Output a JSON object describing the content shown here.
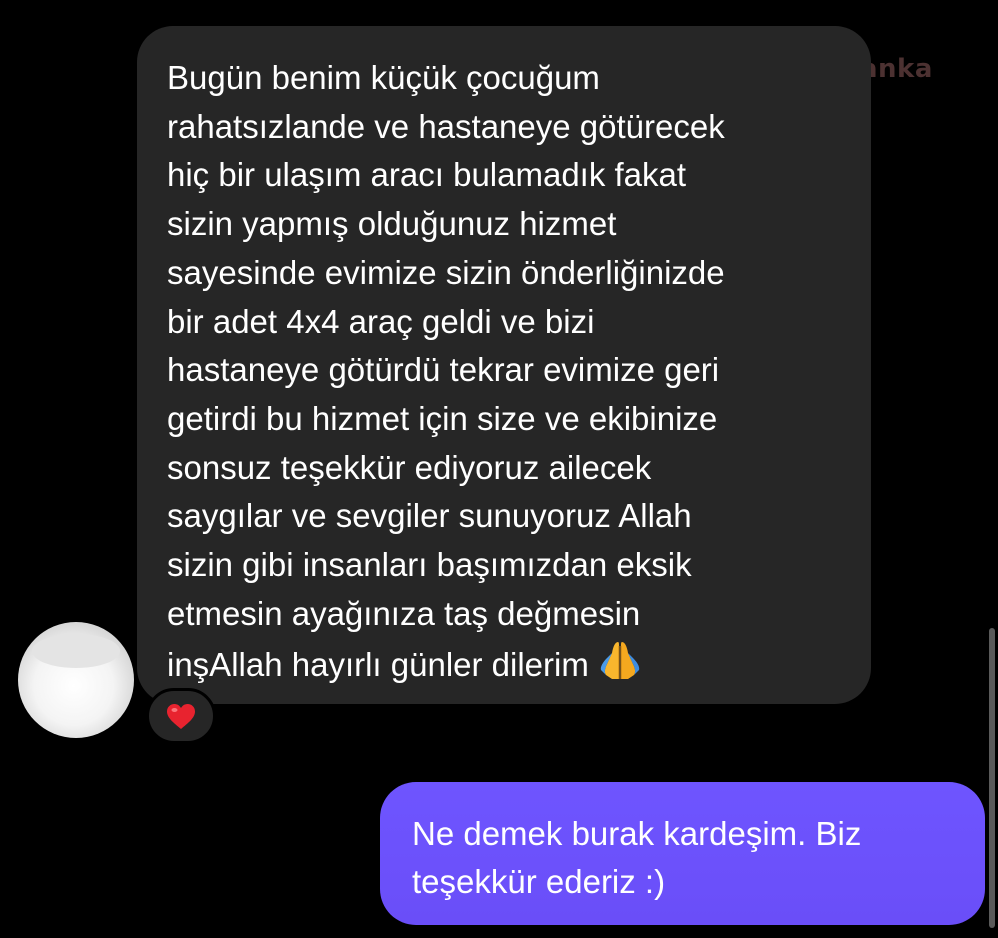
{
  "watermark": {
    "text": "anka",
    "color": "#5a3a3a"
  },
  "incoming_message": {
    "lines": [
      "Bugün benim küçük çocuğum",
      "rahatsızlande ve hastaneye götürecek",
      "hiç bir ulaşım aracı bulamadık fakat",
      "sizin yapmış olduğunuz hizmet",
      "sayesinde evimize sizin önderliğinizde",
      "bir adet 4x4 araç geldi ve bizi",
      "hastaneye götürdü tekrar evimize geri",
      "getirdi bu hizmet için size ve ekibinize",
      "sonsuz teşekkür ediyoruz ailecek",
      "saygılar ve sevgiler sunuyoruz Allah",
      "sizin gibi insanları başımızdan eksik",
      "etmesin ayağınıza taş değmesin",
      "inşAllah hayırlı günler dilerim"
    ],
    "trailing_emoji": "folded-hands-emoji",
    "bubble_color": "#262626",
    "text_color": "#ffffff",
    "reaction": "heart-emoji"
  },
  "sender_avatar": {
    "icon": "avatar-placeholder"
  },
  "outgoing_message": {
    "lines": [
      "Ne demek burak kardeşim. Biz",
      "teşekkür ederiz :)"
    ],
    "bubble_color": "#6a4ef8",
    "text_color": "#ffffff"
  },
  "theme": {
    "background": "#000000"
  }
}
